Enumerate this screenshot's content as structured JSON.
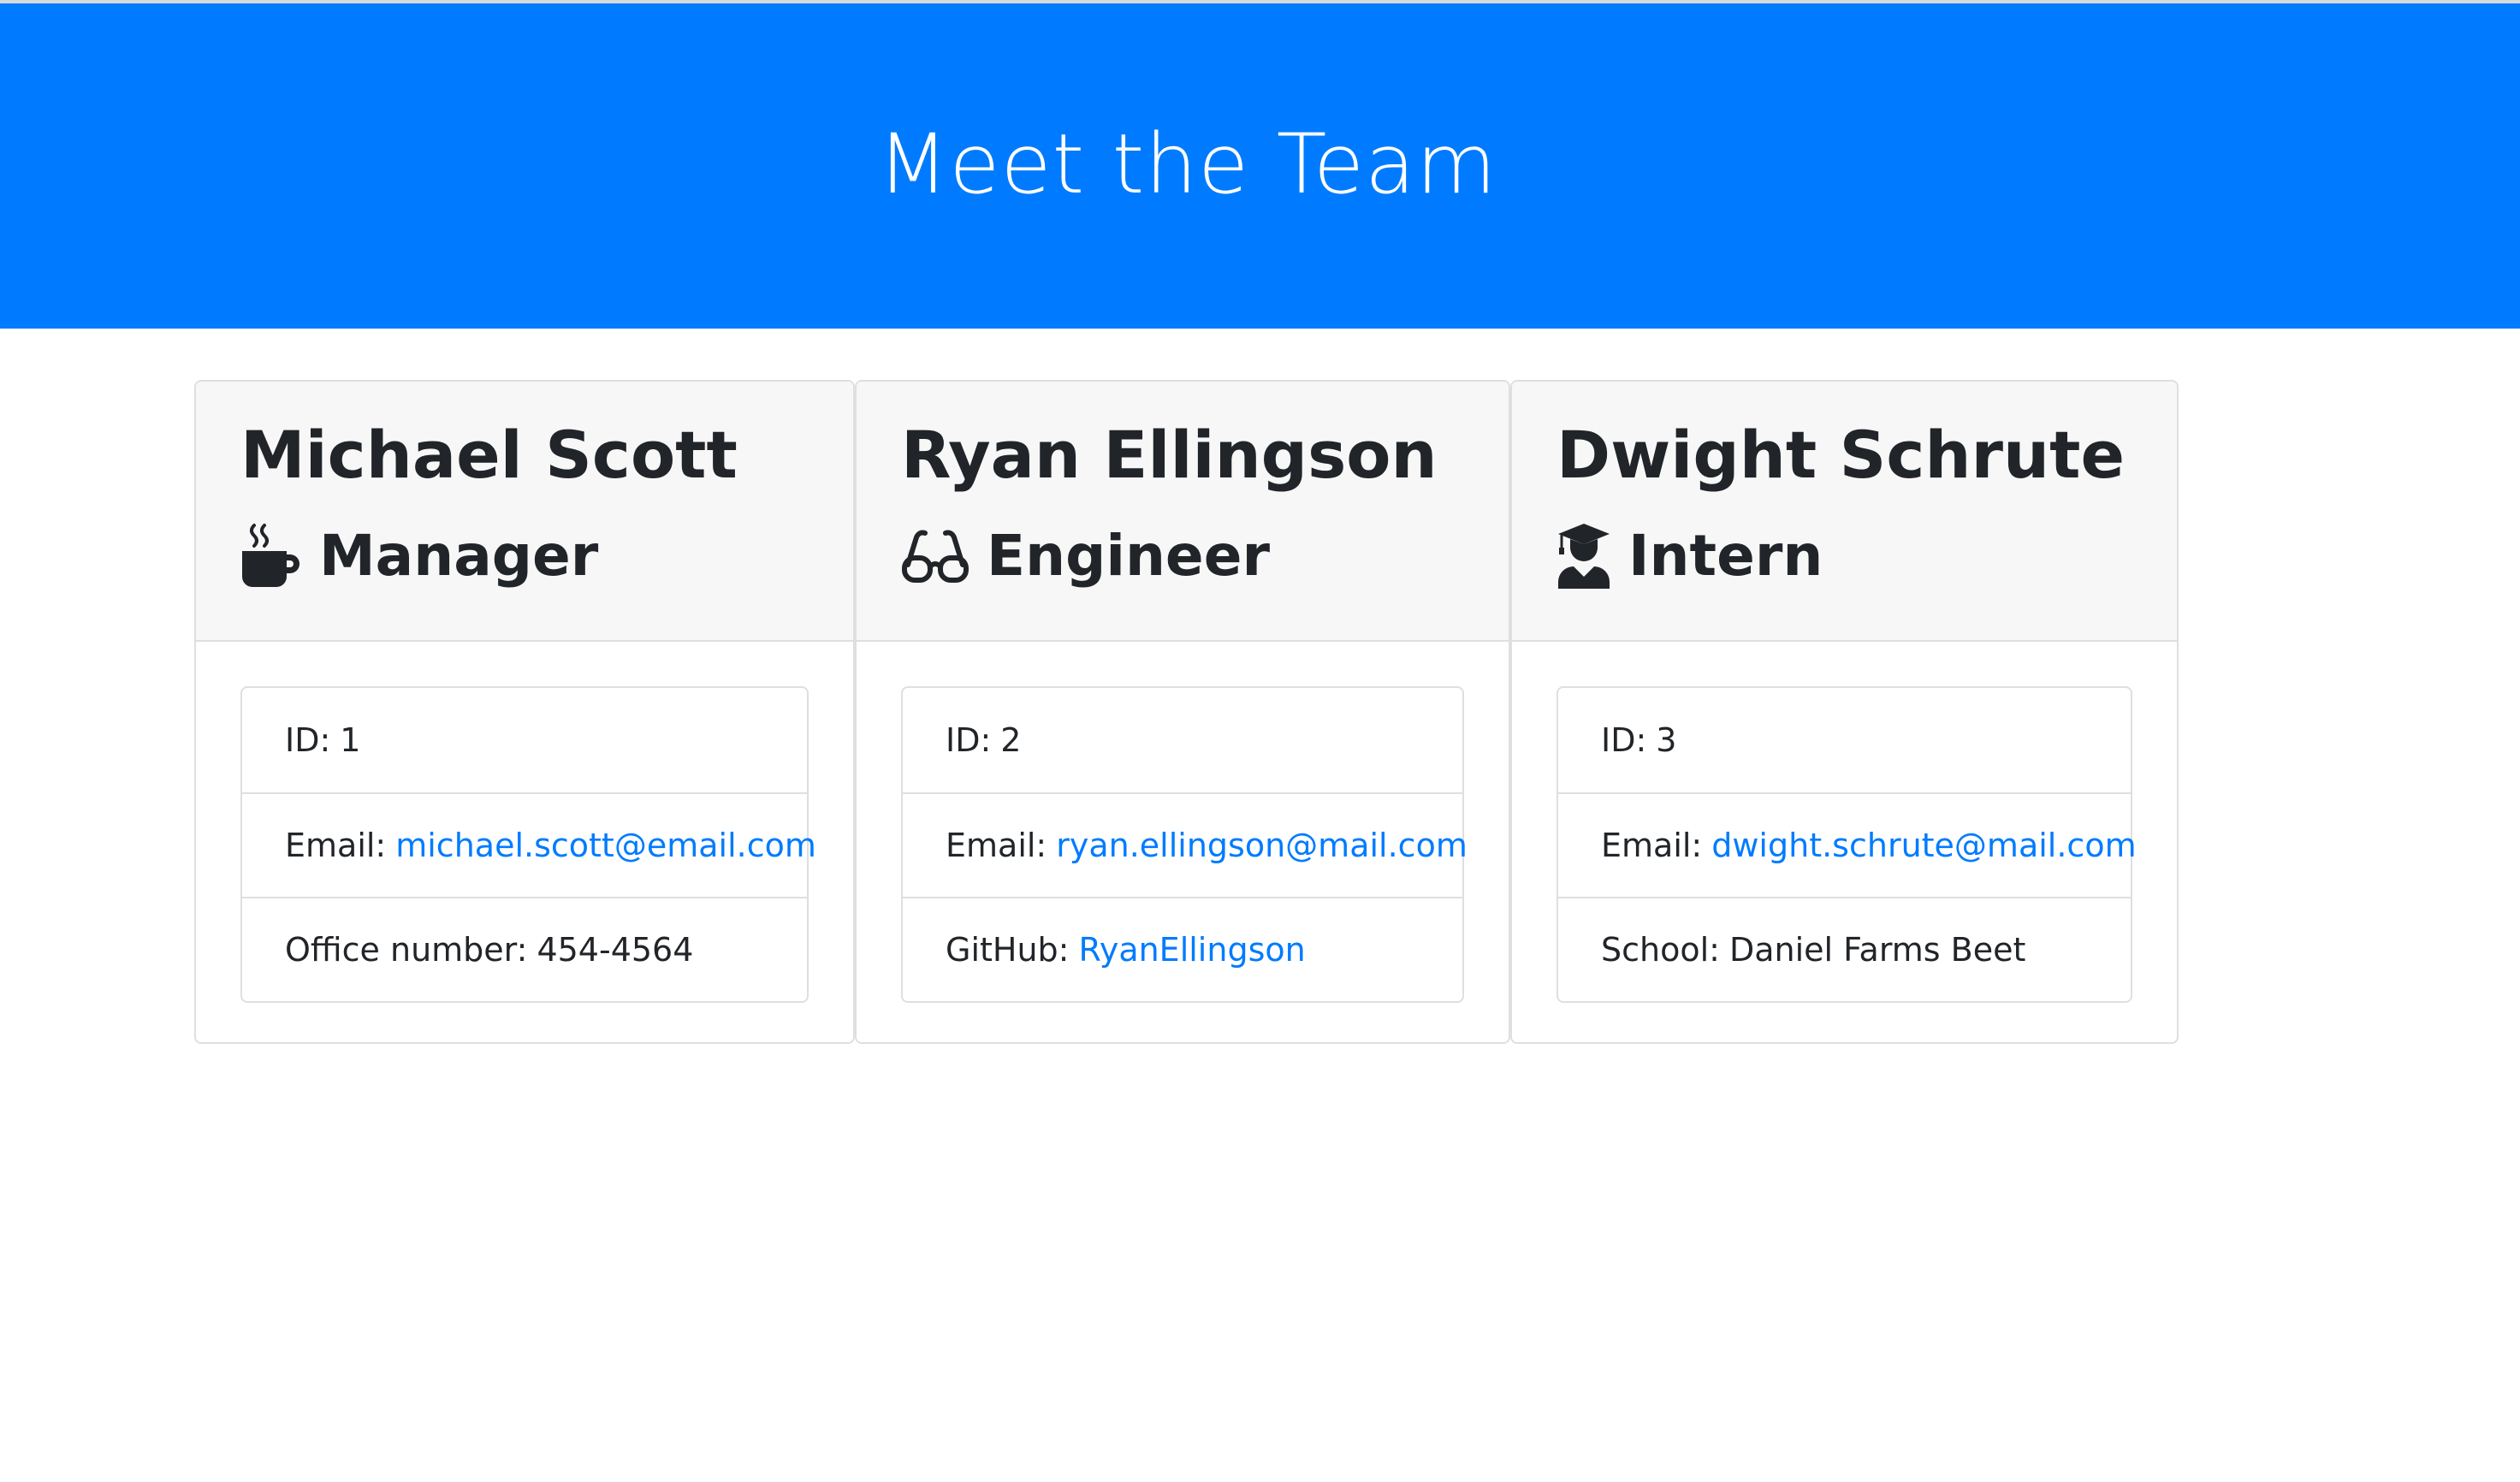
{
  "header": {
    "title": "Meet the Team"
  },
  "colors": {
    "header_bg": "#007bff",
    "link": "#007bff",
    "card_header_bg": "#f7f7f7",
    "text": "#212529"
  },
  "employees": [
    {
      "name": "Michael Scott",
      "role": "Manager",
      "role_icon": "coffee-mug-icon",
      "id_label": "ID:",
      "id": "1",
      "email_label": "Email:",
      "email": "michael.scott@email.com",
      "extra_label": "Office number:",
      "extra_value": "454-4564",
      "extra_is_link": false
    },
    {
      "name": "Ryan Ellingson",
      "role": "Engineer",
      "role_icon": "glasses-icon",
      "id_label": "ID:",
      "id": "2",
      "email_label": "Email:",
      "email": "ryan.ellingson@mail.com",
      "extra_label": "GitHub:",
      "extra_value": "RyanEllingson",
      "extra_is_link": true
    },
    {
      "name": "Dwight Schrute",
      "role": "Intern",
      "role_icon": "graduate-icon",
      "id_label": "ID:",
      "id": "3",
      "email_label": "Email:",
      "email": "dwight.schrute@mail.com",
      "extra_label": "School:",
      "extra_value": "Daniel Farms Beet",
      "extra_is_link": false
    }
  ]
}
